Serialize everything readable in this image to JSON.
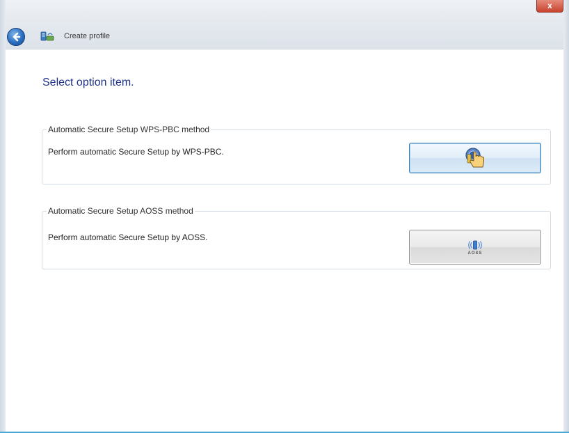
{
  "window": {
    "title": "Create profile",
    "close_label": "x"
  },
  "instruction": "Select option item.",
  "options": [
    {
      "legend": "Automatic Secure Setup WPS-PBC method",
      "description": "Perform automatic Secure Setup by WPS-PBC.",
      "button_icon": "wps-push-button-icon"
    },
    {
      "legend": "Automatic Secure Setup AOSS method",
      "description": "Perform automatic Secure Setup by AOSS.",
      "button_icon": "aoss-icon",
      "button_label": "AOSS"
    }
  ]
}
